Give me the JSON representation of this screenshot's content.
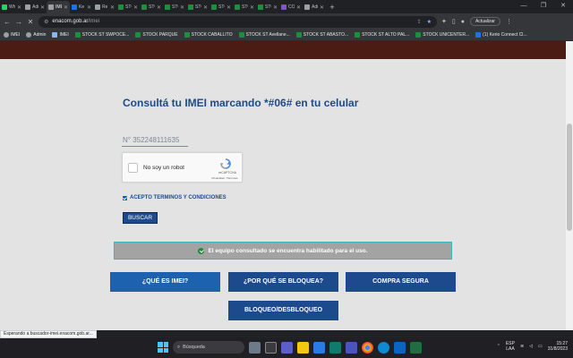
{
  "browser": {
    "tabs": [
      {
        "label": "Wh",
        "color": "#25d366",
        "active": false
      },
      {
        "label": "Adi",
        "color": "#9aa0a6",
        "active": false
      },
      {
        "label": "IME",
        "color": "#9aa0a6",
        "active": true
      },
      {
        "label": "Ke",
        "color": "#1a73e8",
        "active": false
      },
      {
        "label": "Re",
        "color": "#9aa0a6",
        "active": false
      },
      {
        "label": "STC",
        "color": "#1e8e3e",
        "active": false
      },
      {
        "label": "STC",
        "color": "#1e8e3e",
        "active": false
      },
      {
        "label": "STC",
        "color": "#1e8e3e",
        "active": false
      },
      {
        "label": "STC",
        "color": "#1e8e3e",
        "active": false
      },
      {
        "label": "STC",
        "color": "#1e8e3e",
        "active": false
      },
      {
        "label": "STC",
        "color": "#1e8e3e",
        "active": false
      },
      {
        "label": "STC",
        "color": "#1e8e3e",
        "active": false
      },
      {
        "label": "CO",
        "color": "#7e57c2",
        "active": false
      },
      {
        "label": "Adi",
        "color": "#9aa0a6",
        "active": false
      }
    ],
    "new_tab": "+",
    "url_domain": "enacom.gob.ar",
    "url_path": "/imei",
    "update_label": "Actualizar",
    "bookmarks": [
      {
        "label": "IMEI",
        "icon": "globe"
      },
      {
        "label": "Admin",
        "icon": "globe"
      },
      {
        "label": "IMEI",
        "icon": "dl"
      },
      {
        "label": "STOCK ST SWPOCE...",
        "icon": "sheet"
      },
      {
        "label": "STOCK PARQUE",
        "icon": "sheet"
      },
      {
        "label": "STOCK CABALLITO",
        "icon": "sheet"
      },
      {
        "label": "STOCK ST Avellane...",
        "icon": "sheet"
      },
      {
        "label": "STOCK ST ABASTO...",
        "icon": "sheet"
      },
      {
        "label": "STOCK ST ALTO PAL...",
        "icon": "sheet"
      },
      {
        "label": "STOCK UNICENTER...",
        "icon": "sheet"
      },
      {
        "label": "(1) Kerio Connect Cl...",
        "icon": "blue"
      }
    ]
  },
  "page": {
    "heading": "Consultá tu IMEI marcando *#06# en tu celular",
    "imei_value": "N° 352248111635",
    "captcha": {
      "label": "No soy un robot",
      "brand": "reCAPTCHA",
      "links": "Privacidad - Términos"
    },
    "terms_label": "ACEPTO TERMINOS Y CONDICIONES",
    "search_label": "BUSCAR",
    "result_message": "El equipo consultado se encuentra habilitado para el uso.",
    "buttons": {
      "what_is_imei": "¿QUÉ ES IMEI?",
      "why_blocked": "¿POR QUÉ SE BLOQUEA?",
      "safe_purchase": "COMPRA SEGURA",
      "block_unblock": "BLOQUEO/DESBLOQUEO"
    }
  },
  "status_text": "Esperando a buscador-imei.enacom.gob.ar...",
  "taskbar": {
    "search_placeholder": "Búsqueda",
    "lang_top": "ESP",
    "lang_bottom": "LAA",
    "time": "15:27",
    "date": "31/8/2023"
  }
}
